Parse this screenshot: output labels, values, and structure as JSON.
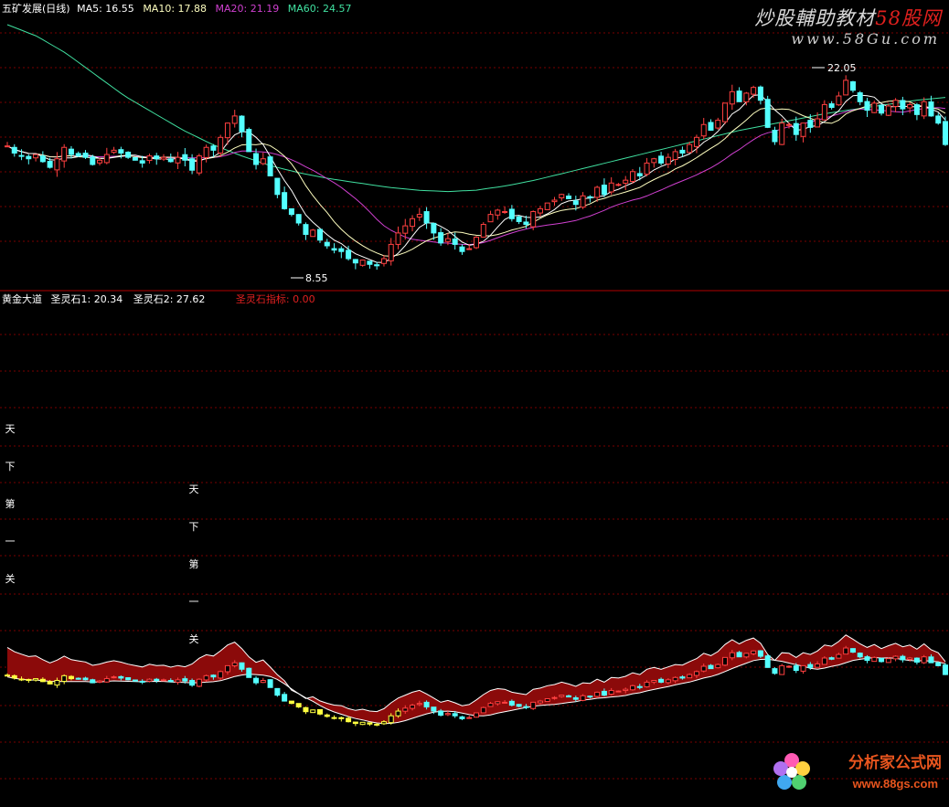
{
  "top_panel": {
    "stock_name": "五矿发展(日线)",
    "ma5": "MA5: 16.55",
    "ma10": "MA10: 17.88",
    "ma20": "MA20: 21.19",
    "ma60": "MA60: 24.57",
    "high_marker": "22.05",
    "low_marker": "8.55"
  },
  "bottom_panel": {
    "indicator_name": "黄金大道",
    "line1": "圣灵石1: 20.34",
    "line2": "圣灵石2: 27.62",
    "signal": "圣灵石指标: 0.00",
    "vertical_text_1": [
      "天",
      "下",
      "第",
      "一",
      "关"
    ],
    "vertical_text_2": [
      "天",
      "下",
      "第",
      "一",
      "关"
    ]
  },
  "watermarks": {
    "top_line1": "炒股輔助教材",
    "top_line1_accent": "58股网",
    "top_line2": "www.58Gu.com",
    "bottom_line1": "分析家公式网",
    "bottom_line2": "www.88gs.com"
  },
  "colors": {
    "background": "#000000",
    "grid": "#7a0000",
    "up_candle": "#ff4040",
    "down_candle": "#54ffff",
    "ma5": "#ffffff",
    "ma10": "#ffffc0",
    "ma20": "#d040d0",
    "ma60": "#40e0a0",
    "band_fill": "#8b0a0a",
    "highlight_candle": "#ffff40"
  },
  "chart_data": {
    "type": "candlestick",
    "price_path": [
      17.5,
      17.0,
      16.8,
      16.6,
      16.9,
      16.4,
      16.0,
      16.6,
      17.4,
      16.9,
      16.8,
      16.7,
      16.2,
      16.5,
      16.9,
      17.2,
      17.0,
      16.7,
      16.5,
      16.3,
      16.8,
      16.6,
      16.7,
      16.4,
      16.7,
      16.5,
      15.8,
      16.8,
      17.4,
      17.2,
      18.1,
      19.1,
      19.6,
      18.5,
      17.1,
      16.2,
      16.6,
      15.4,
      14.1,
      13.1,
      12.7,
      12.1,
      11.3,
      11.6,
      10.9,
      10.5,
      10.2,
      10.1,
      9.6,
      9.3,
      9.5,
      9.2,
      9.1,
      9.6,
      10.6,
      11.4,
      11.9,
      12.4,
      12.7,
      12.1,
      11.4,
      10.7,
      11.0,
      10.6,
      10.1,
      10.3,
      11.1,
      12.0,
      12.7,
      13.0,
      12.9,
      12.4,
      12.2,
      12.0,
      12.9,
      13.1,
      13.5,
      13.7,
      14.1,
      13.8,
      13.4,
      14.0,
      13.9,
      14.6,
      14.1,
      14.9,
      14.8,
      15.1,
      15.7,
      15.4,
      16.3,
      16.6,
      16.3,
      16.7,
      17.1,
      17.0,
      17.6,
      18.1,
      19.0,
      18.6,
      19.3,
      20.5,
      21.3,
      20.6,
      21.2,
      21.6,
      20.7,
      18.8,
      17.8,
      19.1,
      19.0,
      18.3,
      19.1,
      18.8,
      19.4,
      20.4,
      20.2,
      21.0,
      22.1,
      21.4,
      20.6,
      20.0,
      20.5,
      19.8,
      20.3,
      20.7,
      20.1,
      20.4,
      19.7,
      20.6,
      19.6,
      19.1,
      17.6
    ],
    "y_range_top": [
      8.0,
      23.5
    ],
    "ma_labels": [
      "MA5",
      "MA10",
      "MA20",
      "MA60"
    ],
    "high": 22.05,
    "low": 8.55
  }
}
